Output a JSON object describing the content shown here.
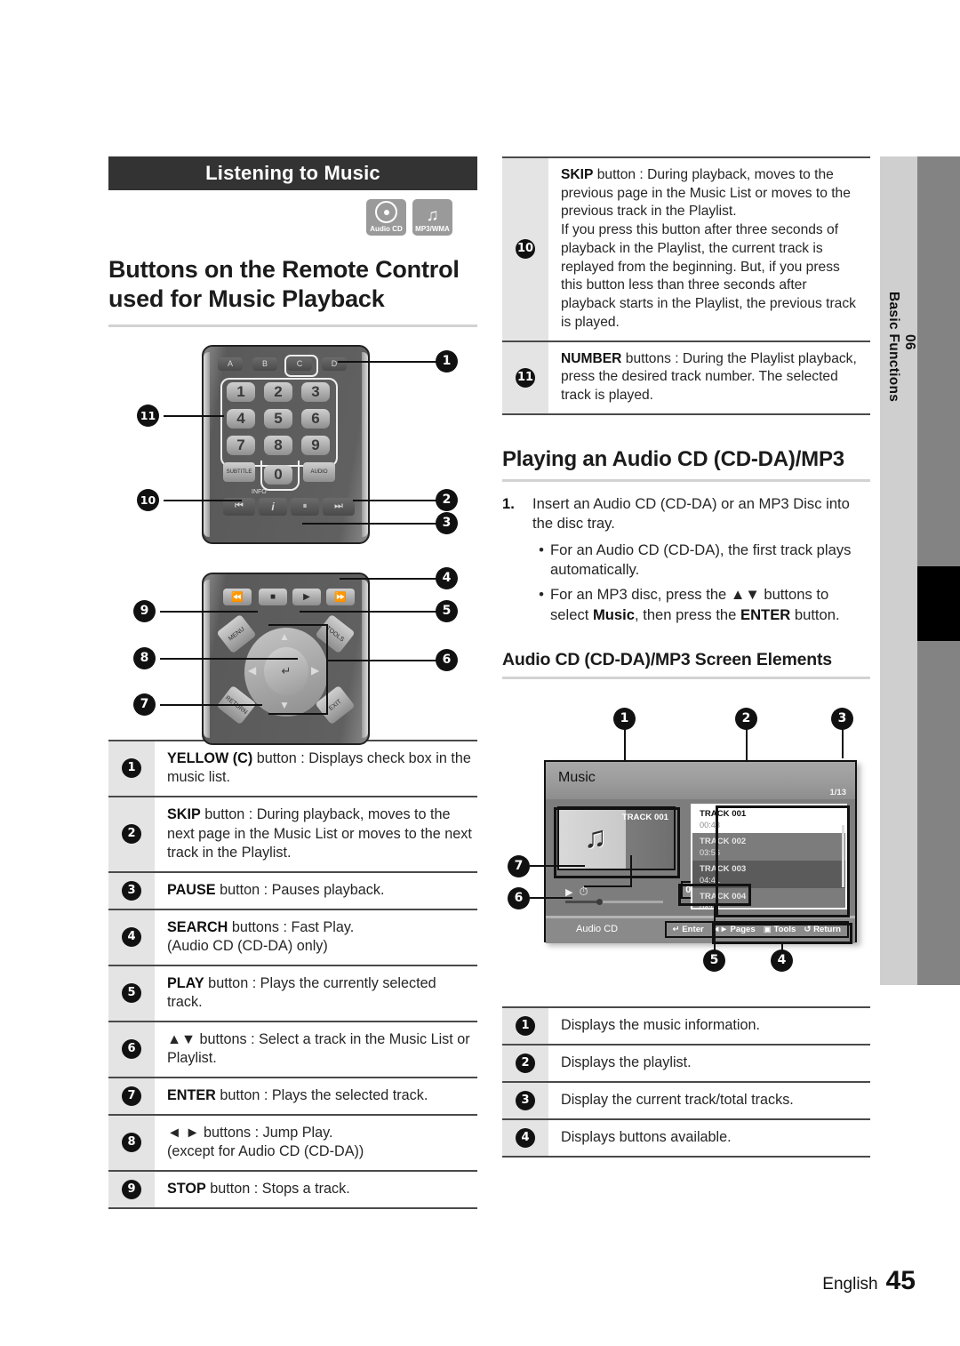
{
  "chapter_tab": {
    "number": "06",
    "title": "Basic Functions"
  },
  "section": {
    "bar_title": "Listening to Music",
    "badges": [
      {
        "icon": "audio-cd-icon",
        "caption": "Audio CD"
      },
      {
        "icon": "music-note-icon",
        "caption": "MP3/WMA"
      }
    ],
    "main_title": "Buttons on the Remote Control used for Music Playback"
  },
  "remote": {
    "color_buttons": [
      "A",
      "B",
      "C",
      "D"
    ],
    "number_buttons": [
      "1",
      "2",
      "3",
      "4",
      "5",
      "6",
      "7",
      "8",
      "9",
      "0"
    ],
    "labels": {
      "subtitle": "SUBTITLE",
      "audio": "AUDIO",
      "info": "INFO",
      "menu": "MENU",
      "tools": "TOOLS",
      "return": "RETURN",
      "exit": "EXIT"
    },
    "callouts": [
      "1",
      "2",
      "3",
      "4",
      "5",
      "6",
      "7",
      "8",
      "9",
      "10",
      "11"
    ]
  },
  "remote_table": [
    {
      "num": "1",
      "text_bold": "YELLOW (C)",
      "text": " button : Displays check box in the music list."
    },
    {
      "num": "2",
      "text_bold": "SKIP",
      "text": " button : During playback, moves to the next page in the Music List or moves to the next track in the Playlist."
    },
    {
      "num": "3",
      "text_bold": "PAUSE",
      "text": " button : Pauses playback."
    },
    {
      "num": "4",
      "text_bold": "SEARCH",
      "text": " buttons : Fast Play.\n(Audio CD (CD-DA) only)"
    },
    {
      "num": "5",
      "text_bold": "PLAY",
      "text": " button : Plays the currently selected track."
    },
    {
      "num": "6",
      "text_bold": "▲▼",
      "text": " buttons : Select a track in the Music List or Playlist."
    },
    {
      "num": "7",
      "text_bold": "ENTER",
      "text": " button : Plays the selected track."
    },
    {
      "num": "8",
      "text_bold": "◄ ►",
      "text": " buttons : Jump Play.\n(except for Audio CD (CD-DA))"
    },
    {
      "num": "9",
      "text_bold": "STOP",
      "text": " button : Stops a track."
    }
  ],
  "remote_table_right": [
    {
      "num": "10",
      "text_bold": "SKIP",
      "text": " button : During playback, moves to the previous page in the Music List or moves to the previous track in the Playlist.\nIf you press this button after three seconds of playback in the Playlist, the current track is replayed from the beginning. But, if you press this button less than three seconds after playback starts in the Playlist, the previous track is played."
    },
    {
      "num": "11",
      "text_bold": "NUMBER",
      "text": " buttons : During the Playlist playback, press the desired track number. The selected track is played."
    }
  ],
  "playing_section": {
    "title": "Playing an Audio CD (CD-DA)/MP3",
    "step_marker": "1.",
    "step_text": "Insert an Audio CD (CD-DA) or an MP3 Disc into the disc tray.",
    "bullets": [
      {
        "dot": "•",
        "text": "For an Audio CD (CD-DA), the first track plays automatically."
      },
      {
        "dot": "•",
        "pre": "For an MP3 disc, press the ▲▼ buttons to select ",
        "bold1": "Music",
        "mid": ", then press the ",
        "bold2": "ENTER",
        "post": " button."
      }
    ],
    "screen_elements_title": "Audio CD (CD-DA)/MP3 Screen Elements"
  },
  "music_screen": {
    "title": "Music",
    "page_indicator": "1/13",
    "album_track_name": "TRACK 001",
    "album_note_icon": "music-note-icon",
    "play_icon": "play-icon",
    "repeat_icon": "repeat-icon",
    "time_display": "00:13 / 00:43",
    "source_label": "Audio CD",
    "playlist": [
      {
        "name": "TRACK 001",
        "duration": "00:43",
        "state": "current"
      },
      {
        "name": "TRACK 002",
        "duration": "03:56",
        "state": "normal"
      },
      {
        "name": "TRACK 003",
        "duration": "04:41",
        "state": "highlight"
      },
      {
        "name": "TRACK 004",
        "duration": "04:02",
        "state": "normal"
      }
    ],
    "key_hints": [
      {
        "icon": "enter-icon",
        "glyph": "↵",
        "label": "Enter"
      },
      {
        "icon": "left-right-icon",
        "glyph": "◄►",
        "label": "Pages"
      },
      {
        "icon": "tools-icon",
        "glyph": "▣",
        "label": "Tools"
      },
      {
        "icon": "return-icon",
        "glyph": "↺",
        "label": "Return"
      }
    ],
    "callouts": [
      "1",
      "2",
      "3",
      "4",
      "5",
      "6",
      "7"
    ]
  },
  "screen_elements_table": [
    {
      "num": "1",
      "text": "Displays the music information."
    },
    {
      "num": "2",
      "text": "Displays the playlist."
    },
    {
      "num": "3",
      "text": "Display the current track/total tracks."
    },
    {
      "num": "4",
      "text": "Displays buttons available."
    }
  ],
  "footer": {
    "language": "English",
    "page_number": "45"
  },
  "colors": {
    "bar": "#333333",
    "tab_light": "#cfcfcf",
    "tab_dark": "#838383",
    "rule": "#d2d2d2"
  }
}
